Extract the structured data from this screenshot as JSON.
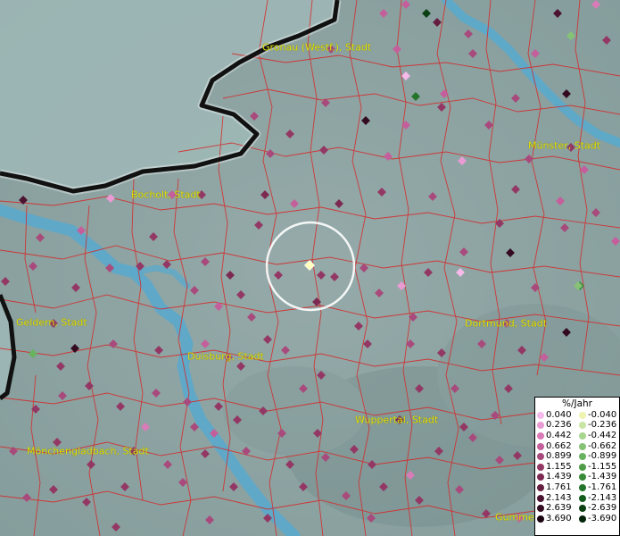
{
  "colors": {
    "rivers": "#5aa9cc",
    "borders": "#d42c2c",
    "state_border": "#111111",
    "label_text": "#e8e400",
    "highlight_point": "#ffffc0",
    "highlight_ring": "#ffffff"
  },
  "city_labels": [
    {
      "name": "Gronau (Westf.), Stadt"
    },
    {
      "name": "Münster, Stadt"
    },
    {
      "name": "Bocholt, Stadt"
    },
    {
      "name": "Geldern, Stadt"
    },
    {
      "name": "Dortmund, Stadt"
    },
    {
      "name": "Duisburg, Stadt"
    },
    {
      "name": "Wuppertal, Stadt"
    },
    {
      "name": "Mönchengladbach, Stadt"
    },
    {
      "name": "Gummers"
    }
  ],
  "legend": {
    "title": "%/Jahr",
    "positive": [
      {
        "value": "0.040",
        "color": "#f5b9ea"
      },
      {
        "value": "0.236",
        "color": "#eb9bd4"
      },
      {
        "value": "0.442",
        "color": "#d97bb7"
      },
      {
        "value": "0.662",
        "color": "#c45f9c"
      },
      {
        "value": "0.899",
        "color": "#a84a7c"
      },
      {
        "value": "1.155",
        "color": "#933864"
      },
      {
        "value": "1.439",
        "color": "#7d2a52"
      },
      {
        "value": "1.761",
        "color": "#651e3f"
      },
      {
        "value": "2.143",
        "color": "#4b1330"
      },
      {
        "value": "2.639",
        "color": "#330a20"
      },
      {
        "value": "3.690",
        "color": "#1a0311"
      }
    ],
    "negative": [
      {
        "value": "-0.040",
        "color": "#eef4b0"
      },
      {
        "value": "-0.236",
        "color": "#c9e4a3"
      },
      {
        "value": "-0.442",
        "color": "#a8d68e"
      },
      {
        "value": "-0.662",
        "color": "#86c276"
      },
      {
        "value": "-0.899",
        "color": "#69b25f"
      },
      {
        "value": "-1.155",
        "color": "#4f9c48"
      },
      {
        "value": "-1.439",
        "color": "#388a38"
      },
      {
        "value": "-1.761",
        "color": "#247429"
      },
      {
        "value": "-2.143",
        "color": "#145c1c"
      },
      {
        "value": "-2.639",
        "color": "#0a4012"
      },
      {
        "value": "-3.690",
        "color": "#03240a"
      }
    ]
  }
}
